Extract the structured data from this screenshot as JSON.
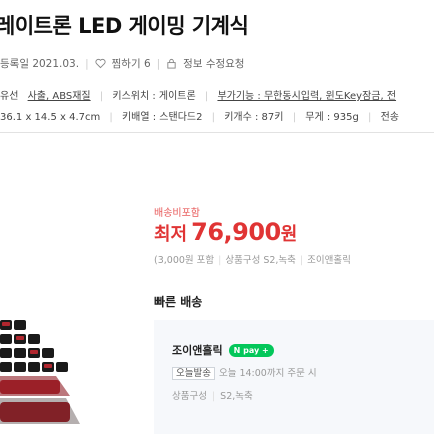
{
  "product": {
    "title": "레이트론 LED 게이밍 기계식"
  },
  "meta": {
    "registered": "등록일 2021.03.",
    "wishlist": "찜하기 6",
    "report": "정보 수정요청"
  },
  "specs": {
    "line1": [
      {
        "text": "유선",
        "underline": false
      },
      {
        "text": "사출, ABS재질",
        "underline": true
      },
      {
        "text": "|",
        "sep": true
      },
      {
        "text": "키스위치 : 게이트론",
        "underline": false
      },
      {
        "text": "|",
        "sep": true
      },
      {
        "text": "부가기능 : 무한동시입력, 윈도Key잠금, 전",
        "underline": true
      }
    ],
    "line2": [
      {
        "text": "36.1 x 14.5 x 4.7cm",
        "sep": false
      },
      {
        "text": "|",
        "sep": true
      },
      {
        "text": "키배열 : 스탠다드2",
        "sep": false
      },
      {
        "text": "|",
        "sep": true
      },
      {
        "text": "키개수 : 87키",
        "sep": false
      },
      {
        "text": "|",
        "sep": true
      },
      {
        "text": "무게 : 935g",
        "sep": false
      },
      {
        "text": "|",
        "sep": true
      },
      {
        "text": "전송",
        "sep": false
      }
    ]
  },
  "price": {
    "shipping_free": "배송비포함",
    "label": "최저",
    "amount": "76,900",
    "currency": "원",
    "shipping_fee": "(3,000원 포함",
    "composition": "상품구성 S2,녹축",
    "seller": "조이앤홀릭"
  },
  "delivery": {
    "heading": "빠른 배송",
    "store_name": "조이앤홀릭",
    "npay": "N pay +",
    "today_badge": "오늘발송",
    "today_text": "오늘 14:00까지 주문 시",
    "composition_label": "상품구성",
    "composition_value": "S2,녹축"
  },
  "colors": {
    "price_red": "#e03434",
    "npay_green": "#03c75a"
  },
  "icons": {
    "wishlist": "heart-icon"
  }
}
